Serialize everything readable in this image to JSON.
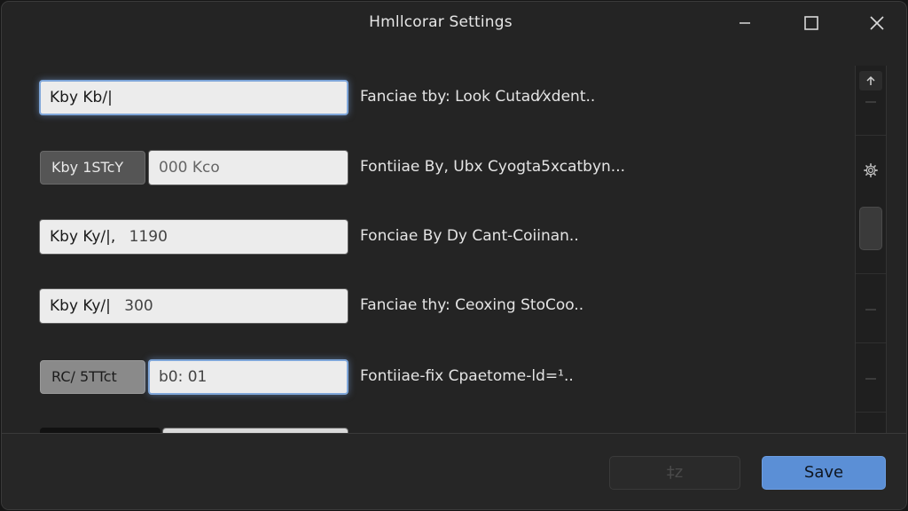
{
  "window": {
    "title": "Hmllcorar Settings"
  },
  "rows": [
    {
      "field_text": "Kby Kb/|",
      "description": "Fanciae tby: Look Cutad⁄xdent.."
    },
    {
      "tag": "Kby 1STcY",
      "field_text": "000 Kco",
      "description": "Fontiiae By, Ubx Cyogta5xcatbyn..."
    },
    {
      "field_text": "Kby Ky/|,",
      "field_value": "1190",
      "description": "Fonciae By Dy Cant-Coiinan.."
    },
    {
      "field_text": "Kby Ky/|",
      "field_value": "300",
      "description": "Fanciae thy: Ceoxing StoCoo.."
    },
    {
      "tag": "RC/ 5TTct",
      "field_text": "b0: 01",
      "description": "Fontiiae-fix Cpaetome-ld=¹.."
    }
  ],
  "footer": {
    "secondary_label": "‡z",
    "save_label": "Save"
  },
  "colors": {
    "accent": "#5b8fd6",
    "focus_ring": "#7fa6d9",
    "window_bg": "#242424"
  },
  "icons": {
    "minimize": "minimize-icon",
    "maximize": "maximize-icon",
    "close": "close-icon",
    "scroll_up": "arrow-up-icon",
    "scroll_settings": "gear-icon"
  }
}
